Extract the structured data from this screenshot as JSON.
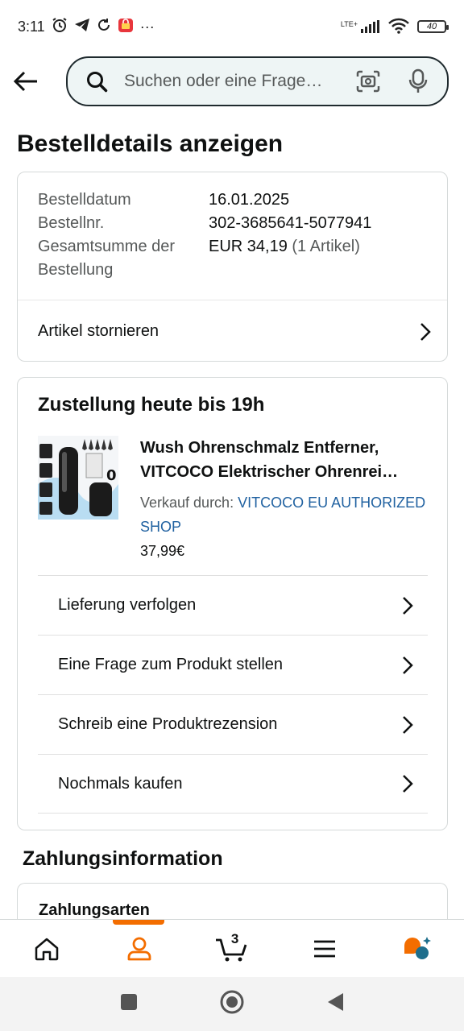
{
  "status_bar": {
    "time": "3:11",
    "more": "···",
    "network": "LTE+",
    "battery": "40"
  },
  "search": {
    "placeholder": "Suchen oder eine Frage…"
  },
  "page": {
    "title": "Bestelldetails anzeigen"
  },
  "order_summary": {
    "rows": [
      {
        "label": "Bestelldatum",
        "value": "16.01.2025",
        "extra": ""
      },
      {
        "label": "Bestellnr.",
        "value": "302-3685641-5077941",
        "extra": ""
      },
      {
        "label": "Gesamtsumme der Bestellung",
        "value": "EUR 34,19",
        "extra": " (1 Artikel)"
      }
    ],
    "cancel_label": "Artikel stornieren"
  },
  "shipment": {
    "title": "Zustellung heute bis 19h",
    "product": {
      "title_line1": "Wush Ohrenschmalz Entferner,",
      "title_line2": "VITCOCO Elektrischer Ohrenrei…",
      "seller_prefix": "Verkauf durch: ",
      "seller_name": "VITCOCO EU AUTHORIZED SHOP",
      "price": "37,99€"
    },
    "actions": [
      "Lieferung verfolgen",
      "Eine Frage zum Produkt stellen",
      "Schreib eine Produktrezension",
      "Nochmals kaufen"
    ]
  },
  "payment": {
    "section_title": "Zahlungsinformation",
    "card_title": "Zahlungsarten"
  },
  "bottom_nav": {
    "cart_count": "3"
  },
  "colors": {
    "accent": "#f36d00",
    "link": "#2162a1",
    "ai_blue": "#1e6e8c"
  }
}
